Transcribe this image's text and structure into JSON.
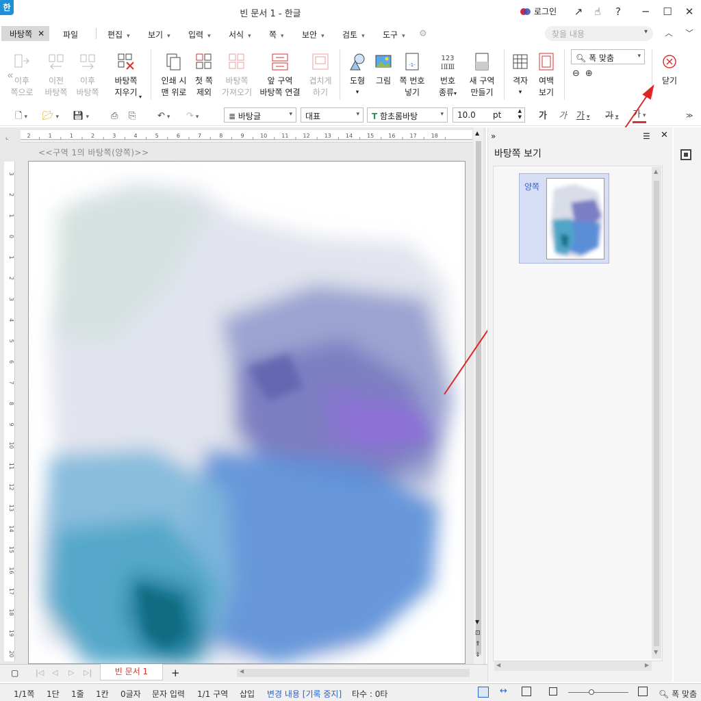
{
  "window": {
    "title": "빈 문서 1 - 한글",
    "app_icon": "한",
    "login_label": "로그인",
    "buttons": [
      "↗",
      "☝",
      "?",
      "─",
      "☐",
      "✕"
    ]
  },
  "menu": {
    "active_tab": "바탕쪽",
    "items": [
      "파일",
      "편집",
      "보기",
      "입력",
      "서식",
      "쪽",
      "보안",
      "검토",
      "도구"
    ],
    "search_placeholder": "찾을 내용"
  },
  "ribbon": {
    "buttons": [
      {
        "label1": "이후",
        "label2": "쪽으로",
        "disabled": true
      },
      {
        "label1": "이전",
        "label2": "바탕쪽",
        "disabled": true
      },
      {
        "label1": "이후",
        "label2": "바탕쪽",
        "disabled": true
      },
      {
        "label1": "바탕쪽",
        "label2": "지우기",
        "disabled": false
      },
      {
        "label1": "인쇄 시",
        "label2": "맨 위로",
        "disabled": false
      },
      {
        "label1": "첫 쪽",
        "label2": "제외",
        "disabled": false
      },
      {
        "label1": "바탕쪽",
        "label2": "가져오기",
        "disabled": true
      },
      {
        "label1": "앞 구역",
        "label2": "바탕쪽 연결",
        "disabled": false
      },
      {
        "label1": "겹치게",
        "label2": "하기",
        "disabled": true
      },
      {
        "label1": "도형",
        "label2": "",
        "disabled": false
      },
      {
        "label1": "그림",
        "label2": "",
        "disabled": false
      },
      {
        "label1": "쪽 번호",
        "label2": "넣기",
        "disabled": false
      },
      {
        "label1": "번호",
        "label2": "종류",
        "disabled": false
      },
      {
        "label1": "새 구역",
        "label2": "만들기",
        "disabled": false
      },
      {
        "label1": "격자",
        "label2": "",
        "disabled": false
      },
      {
        "label1": "여백",
        "label2": "보기",
        "disabled": false
      }
    ],
    "zoom_value": "폭 맞춤",
    "close_label": "닫기"
  },
  "toolbar": {
    "style": "바탕글",
    "language": "대표",
    "font": "함초롬바탕",
    "size": "10.0",
    "unit": "pt",
    "format_glyphs": [
      "가",
      "가",
      "가",
      "가",
      "가"
    ]
  },
  "document": {
    "section_label": "<<구역 1의 바탕쪽(양쪽)>>",
    "ruler_h": [
      "2",
      "1",
      "1",
      "2",
      "3",
      "4",
      "5",
      "6",
      "7",
      "8",
      "9",
      "10",
      "11",
      "12",
      "13",
      "14",
      "15",
      "16",
      "17",
      "18"
    ],
    "ruler_v": [
      "3",
      "2",
      "1",
      "0",
      "1",
      "2",
      "3",
      "4",
      "5",
      "6",
      "7",
      "8",
      "9",
      "10",
      "11",
      "12",
      "13",
      "14",
      "15",
      "16",
      "17",
      "18",
      "19",
      "20"
    ],
    "tab_name": "빈 문서 1"
  },
  "panel": {
    "title": "바탕쪽 보기",
    "thumb_label": "양쪽"
  },
  "status": {
    "page": "1/1쪽",
    "column": "1단",
    "line": "1줄",
    "col": "1칸",
    "chars": "0글자",
    "mode": "문자 입력",
    "section": "1/1 구역",
    "insert": "삽입",
    "track": "변경 내용 [기록 중지]",
    "strokes": "타수 : 0타",
    "zoom": "폭 맞춤"
  },
  "colors": {
    "accent_red": "#d93030",
    "annotation_arrow": "#e02424",
    "brand_blue": "#1e90d8"
  }
}
